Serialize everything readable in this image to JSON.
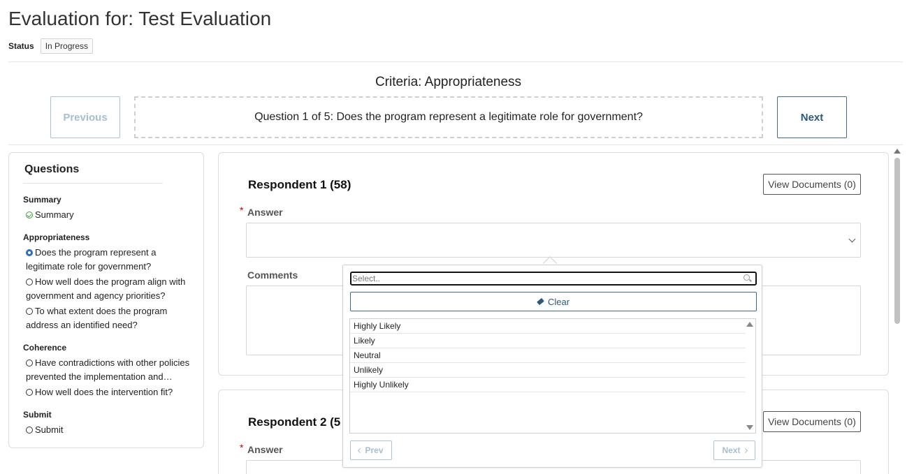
{
  "header": {
    "title": "Evaluation for: Test Evaluation",
    "status_label": "Status",
    "status_value": "In Progress"
  },
  "criteria": {
    "title": "Criteria: Appropriateness",
    "previous_label": "Previous",
    "next_label": "Next",
    "question_text": "Question 1 of 5: Does the program represent a legitimate role for government?"
  },
  "sidebar": {
    "title": "Questions",
    "groups": [
      {
        "title": "Summary",
        "items": [
          {
            "label": "Summary",
            "state": "complete"
          }
        ]
      },
      {
        "title": "Appropriateness",
        "items": [
          {
            "label": "Does the program represent a legitimate role for government?",
            "state": "current"
          },
          {
            "label": "How well does the program align with government and agency priorities?",
            "state": "not-started"
          },
          {
            "label": "To what extent does the program address an identified need?",
            "state": "not-started"
          }
        ]
      },
      {
        "title": "Coherence",
        "items": [
          {
            "label": "Have contradictions with other policies prevented the implementation and…",
            "state": "not-started"
          },
          {
            "label": "How well does the intervention fit?",
            "state": "not-started"
          }
        ]
      },
      {
        "title": "Submit",
        "items": [
          {
            "label": "Submit",
            "state": "not-started"
          }
        ]
      }
    ]
  },
  "respondents": [
    {
      "title": "Respondent 1 (58)",
      "view_docs_label": "View Documents (0)",
      "answer_label": "Answer",
      "comments_label": "Comments"
    },
    {
      "title": "Respondent 2 (5",
      "view_docs_label": "View Documents (0)",
      "answer_label": "Answer"
    }
  ],
  "dropdown": {
    "search_placeholder": "Select..",
    "clear_label": "Clear",
    "options": [
      "Highly Likely",
      "Likely",
      "Neutral",
      "Unlikely",
      "Highly Unlikely"
    ],
    "prev_label": "Prev",
    "next_label": "Next"
  },
  "icons": {
    "complete": "check-circle-icon",
    "current": "filled-circle-icon",
    "not_started": "empty-circle-icon",
    "search": "search-icon",
    "clear": "eraser-icon"
  },
  "colors": {
    "accent": "#2c5a7e",
    "complete": "#3aa13a",
    "current": "#2c6fbd",
    "required": "#cc0000"
  }
}
